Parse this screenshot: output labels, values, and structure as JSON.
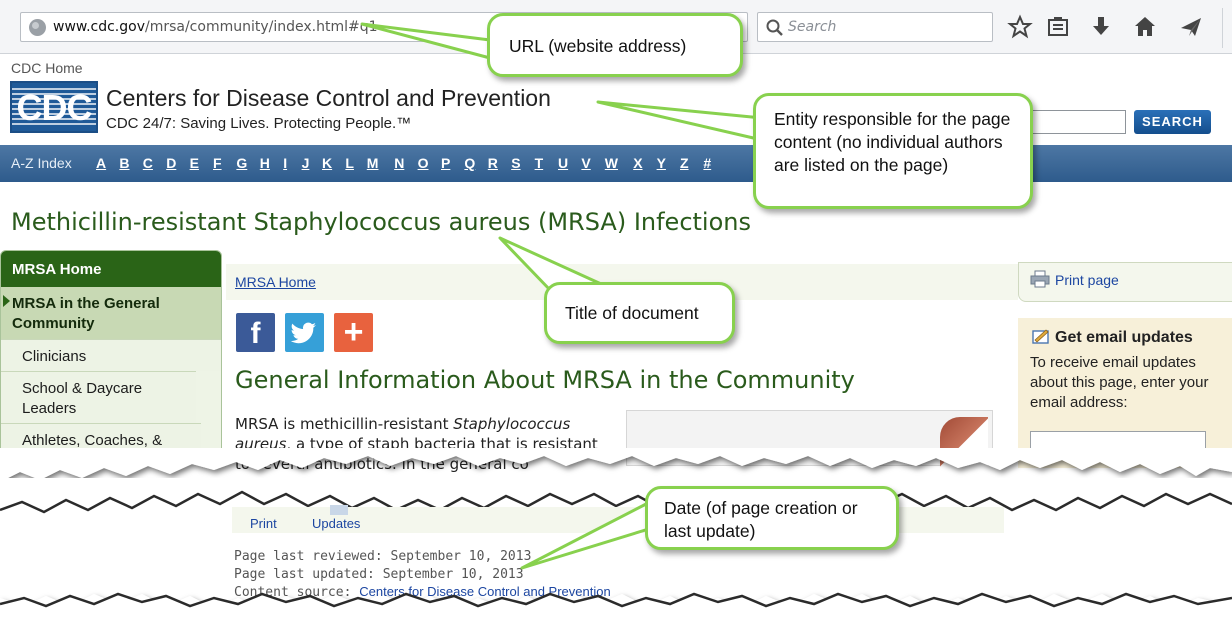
{
  "browser": {
    "url_domain": "www.cdc.gov",
    "url_path": "/mrsa/community/index.html#q1",
    "search_placeholder": "Search",
    "toolbar_icons": [
      "star-icon",
      "reading-list-icon",
      "download-icon",
      "home-icon",
      "send-icon"
    ]
  },
  "header": {
    "cdc_home": "CDC Home",
    "logo_text": "CDC",
    "org_name": "Centers for Disease Control and Prevention",
    "tagline": "CDC 24/7: Saving Lives. Protecting People.™",
    "search_button": "SEARCH"
  },
  "az_index": {
    "label": "A-Z Index",
    "letters": [
      "A",
      "B",
      "C",
      "D",
      "E",
      "F",
      "G",
      "H",
      "I",
      "J",
      "K",
      "L",
      "M",
      "N",
      "O",
      "P",
      "Q",
      "R",
      "S",
      "T",
      "U",
      "V",
      "W",
      "X",
      "Y",
      "Z",
      "#"
    ]
  },
  "page": {
    "title": "Methicillin-resistant Staphylococcus aureus (MRSA) Infections",
    "breadcrumb": "MRSA Home",
    "section_heading": "General Information About MRSA in the Community",
    "body_text_1": "MRSA is methicillin-resistant ",
    "body_text_em": "Staphylococcus aureus",
    "body_text_2": ", a type of staph bacteria that is resistant",
    "body_text_3": "to several antibiotics. In the general co"
  },
  "social": {
    "facebook": "f",
    "plus": "+"
  },
  "left_nav": {
    "home": "MRSA Home",
    "current": "MRSA in the General Community",
    "items": [
      "Clinicians",
      "School & Daycare Leaders",
      "Athletes, Coaches, & Team Healthcare"
    ]
  },
  "right_col": {
    "print_page": "Print page",
    "email_title": "Get email updates",
    "email_desc": "To receive email updates about this page, enter your email address:"
  },
  "footer": {
    "print": "Print",
    "updates": "Updates",
    "reviewed": "Page last reviewed: September 10, 2013",
    "updated": "Page last updated: September 10, 2013",
    "source_label": "Content source: ",
    "source_link": "Centers for Disease Control and Prevention"
  },
  "callouts": {
    "url": "URL (website address)",
    "entity": "Entity responsible for the page content (no individual authors are listed on the page)",
    "title": "Title of document",
    "date": "Date (of page creation or last update)"
  },
  "colors": {
    "callout_border": "#88d14e",
    "heading_green": "#2a5b1c",
    "nav_green": "#2a6417",
    "az_blue": "#2e5b8c",
    "link_blue": "#1c46a1"
  }
}
